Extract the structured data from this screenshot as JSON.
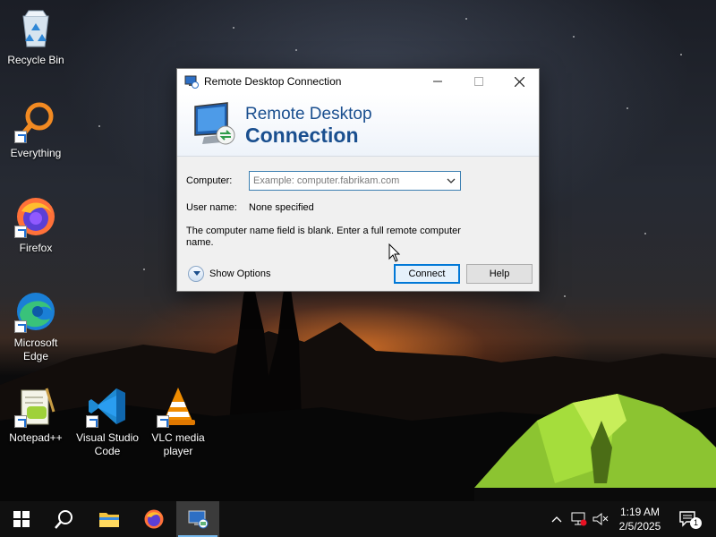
{
  "desktop": {
    "icons": [
      {
        "label": "Recycle Bin",
        "icon": "recycle-bin-icon"
      },
      {
        "label": "Everything",
        "icon": "everything-search-icon"
      },
      {
        "label": "Firefox",
        "icon": "firefox-icon"
      },
      {
        "label": "Microsoft Edge",
        "icon": "edge-icon"
      },
      {
        "label": "Notepad++",
        "icon": "notepadpp-icon"
      },
      {
        "label": "Visual Studio Code",
        "icon": "vscode-icon"
      },
      {
        "label": "VLC media player",
        "icon": "vlc-icon"
      }
    ]
  },
  "window": {
    "title": "Remote Desktop Connection",
    "banner_line1": "Remote Desktop",
    "banner_line2": "Connection",
    "computer_label": "Computer:",
    "computer_value": "",
    "computer_placeholder": "Example: computer.fabrikam.com",
    "username_label": "User name:",
    "username_value": "None specified",
    "message": "The computer name field is blank. Enter a full remote computer name.",
    "show_options_label": "Show Options",
    "connect_label": "Connect",
    "help_label": "Help"
  },
  "taskbar": {
    "items": [
      "start-icon",
      "search-icon",
      "file-explorer-icon",
      "firefox-icon",
      "remote-desktop-icon"
    ],
    "active_item": "remote-desktop-icon",
    "time": "1:19 AM",
    "date": "2/5/2025",
    "notification_count": "1"
  },
  "colors": {
    "accent": "#0078d7",
    "banner_text": "#1a4f8f",
    "taskbar": "#101010"
  }
}
